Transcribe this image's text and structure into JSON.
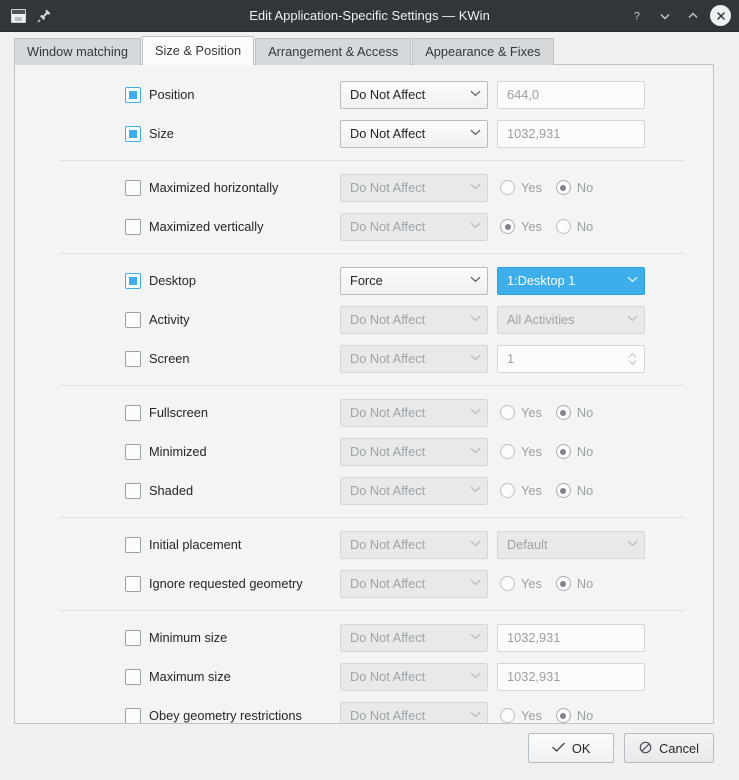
{
  "window": {
    "title": "Edit Application-Specific Settings — KWin",
    "icons": {
      "app": "window-icon",
      "pin": "pin-icon"
    },
    "controls": {
      "help": "?",
      "minimize": "⌄",
      "maximize": "⌃",
      "close": "✕"
    }
  },
  "tabs": [
    {
      "label": "Window matching",
      "active": false
    },
    {
      "label": "Size & Position",
      "active": true
    },
    {
      "label": "Arrangement & Access",
      "active": false
    },
    {
      "label": "Appearance & Fixes",
      "active": false
    }
  ],
  "colors": {
    "highlight": "#3daee9",
    "titlebar": "#31363b",
    "panel": "#f3f4f4",
    "window": "#eff0f1"
  },
  "options": {
    "do_not_affect": "Do Not Affect",
    "force": "Force",
    "yes": "Yes",
    "no": "No"
  },
  "groups": [
    {
      "rows": [
        {
          "label": "Position",
          "checked": "tri",
          "mode": "Do Not Affect",
          "mode_disabled": false,
          "value_type": "text",
          "value": "644,0"
        },
        {
          "label": "Size",
          "checked": "tri",
          "mode": "Do Not Affect",
          "mode_disabled": false,
          "value_type": "text",
          "value": "1032,931"
        }
      ]
    },
    {
      "rows": [
        {
          "label": "Maximized horizontally",
          "checked": "off",
          "mode": "Do Not Affect",
          "mode_disabled": true,
          "value_type": "radio",
          "yes_label": "Yes",
          "no_label": "No",
          "selected": "No"
        },
        {
          "label": "Maximized vertically",
          "checked": "off",
          "mode": "Do Not Affect",
          "mode_disabled": true,
          "value_type": "radio",
          "yes_label": "Yes",
          "no_label": "No",
          "selected": "Yes"
        }
      ]
    },
    {
      "rows": [
        {
          "label": "Desktop",
          "checked": "tri",
          "mode": "Force",
          "mode_disabled": false,
          "value_type": "combo",
          "value": "1:Desktop 1",
          "value_highlight": true
        },
        {
          "label": "Activity",
          "checked": "off",
          "mode": "Do Not Affect",
          "mode_disabled": true,
          "value_type": "combo",
          "value": "All Activities",
          "value_highlight": false
        },
        {
          "label": "Screen",
          "checked": "off",
          "mode": "Do Not Affect",
          "mode_disabled": true,
          "value_type": "spin",
          "value": "1"
        }
      ]
    },
    {
      "rows": [
        {
          "label": "Fullscreen",
          "checked": "off",
          "mode": "Do Not Affect",
          "mode_disabled": true,
          "value_type": "radio",
          "yes_label": "Yes",
          "no_label": "No",
          "selected": "No"
        },
        {
          "label": "Minimized",
          "checked": "off",
          "mode": "Do Not Affect",
          "mode_disabled": true,
          "value_type": "radio",
          "yes_label": "Yes",
          "no_label": "No",
          "selected": "No"
        },
        {
          "label": "Shaded",
          "checked": "off",
          "mode": "Do Not Affect",
          "mode_disabled": true,
          "value_type": "radio",
          "yes_label": "Yes",
          "no_label": "No",
          "selected": "No"
        }
      ]
    },
    {
      "rows": [
        {
          "label": "Initial placement",
          "checked": "off",
          "mode": "Do Not Affect",
          "mode_disabled": true,
          "value_type": "combo",
          "value": "Default",
          "value_highlight": false
        },
        {
          "label": "Ignore requested geometry",
          "checked": "off",
          "mode": "Do Not Affect",
          "mode_disabled": true,
          "value_type": "radio",
          "yes_label": "Yes",
          "no_label": "No",
          "selected": "No"
        }
      ]
    },
    {
      "rows": [
        {
          "label": "Minimum size",
          "checked": "off",
          "mode": "Do Not Affect",
          "mode_disabled": true,
          "value_type": "text",
          "value": "1032,931"
        },
        {
          "label": "Maximum size",
          "checked": "off",
          "mode": "Do Not Affect",
          "mode_disabled": true,
          "value_type": "text",
          "value": "1032,931"
        },
        {
          "label": "Obey geometry restrictions",
          "checked": "off",
          "mode": "Do Not Affect",
          "mode_disabled": true,
          "value_type": "radio",
          "yes_label": "Yes",
          "no_label": "No",
          "selected": "No"
        }
      ]
    }
  ],
  "footer": {
    "ok": {
      "label": "OK",
      "icon": "✓"
    },
    "cancel": {
      "label": "Cancel",
      "icon": "⃠"
    }
  }
}
